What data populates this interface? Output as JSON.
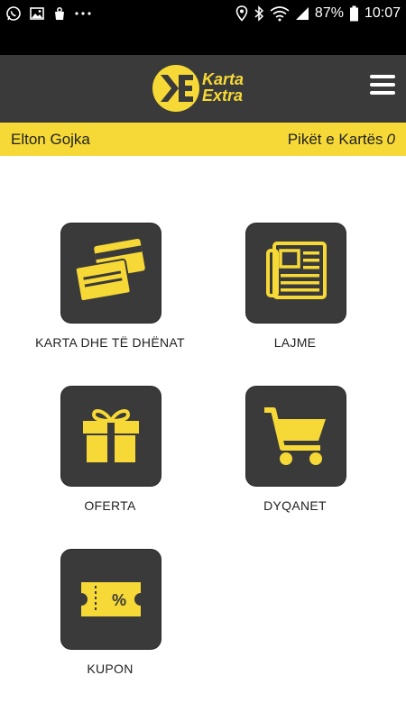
{
  "status_bar": {
    "battery": "87%",
    "time": "10:07"
  },
  "app_bar": {
    "logo_line1": "Karta",
    "logo_line2": "Extra"
  },
  "info_bar": {
    "user_name": "Elton Gojka",
    "points_label": "Pikët e Kartës",
    "points_value": "0"
  },
  "menu": {
    "items": [
      {
        "label": "KARTA DHE TË DHËNAT",
        "icon": "cards-icon"
      },
      {
        "label": "LAJME",
        "icon": "newspaper-icon"
      },
      {
        "label": "OFERTA",
        "icon": "gift-icon"
      },
      {
        "label": "DYQANET",
        "icon": "cart-icon"
      },
      {
        "label": "KUPON",
        "icon": "coupon-icon"
      }
    ]
  },
  "colors": {
    "accent": "#f6d936",
    "dark": "#3a3a3a"
  }
}
